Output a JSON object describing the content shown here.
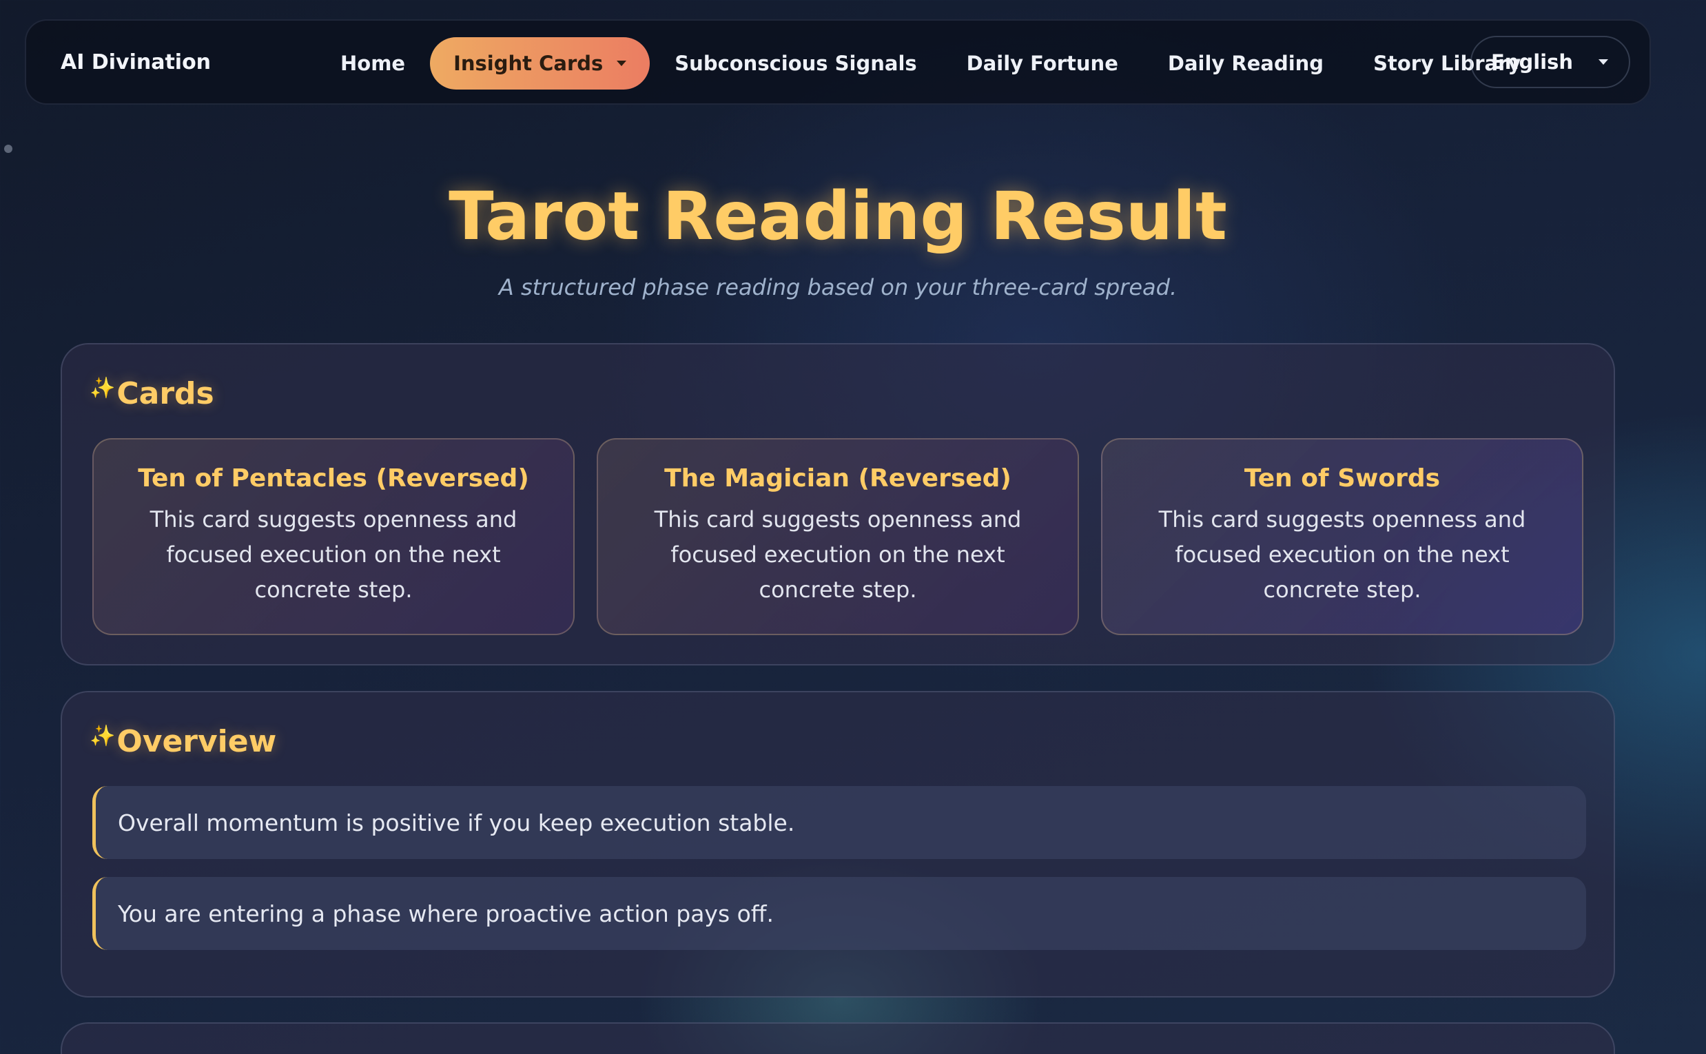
{
  "nav": {
    "brand": "AI Divination",
    "items": [
      {
        "label": "Home"
      },
      {
        "label": "Insight Cards",
        "active": true
      },
      {
        "label": "Subconscious Signals"
      },
      {
        "label": "Daily Fortune"
      },
      {
        "label": "Daily Reading"
      },
      {
        "label": "Story Library"
      }
    ],
    "language": "English"
  },
  "header": {
    "title": "Tarot Reading Result",
    "subtitle": "A structured phase reading based on your three-card spread."
  },
  "cards_section": {
    "icon": "sparkles-icon",
    "title": "Cards",
    "cards": [
      {
        "name": "Ten of Pentacles (Reversed)",
        "text": "This card suggests openness and focused execution on the next concrete step."
      },
      {
        "name": "The Magician (Reversed)",
        "text": "This card suggests openness and focused execution on the next concrete step."
      },
      {
        "name": "Ten of Swords",
        "text": "This card suggests openness and focused execution on the next concrete step."
      }
    ]
  },
  "overview_section": {
    "icon": "sparkles-icon",
    "title": "Overview",
    "lines": [
      "Overall momentum is positive if you keep execution stable.",
      "You are entering a phase where proactive action pays off."
    ]
  },
  "colors": {
    "accent_gold": "#ffcc66",
    "active_tab_gradient_start": "#eeaa62",
    "active_tab_gradient_end": "#eb7d62"
  }
}
